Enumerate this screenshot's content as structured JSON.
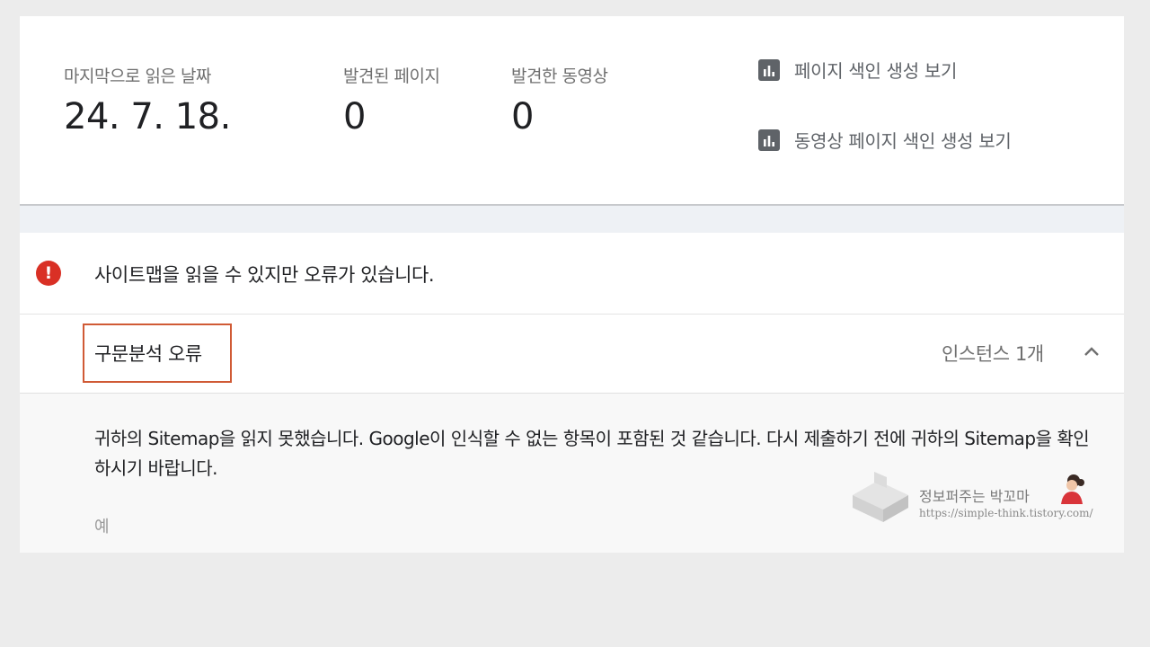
{
  "stats": {
    "last_read": {
      "label": "마지막으로 읽은 날짜",
      "value": "24. 7. 18."
    },
    "pages_found": {
      "label": "발견된 페이지",
      "value": "0"
    },
    "videos_found": {
      "label": "발견한 동영상",
      "value": "0"
    }
  },
  "links": {
    "page_indexing": {
      "label": "페이지 색인 생성 보기",
      "icon": "bar-chart-icon"
    },
    "video_indexing": {
      "label": "동영상 페이지 색인 생성 보기",
      "icon": "bar-chart-icon"
    }
  },
  "error": {
    "icon": "error-icon",
    "icon_glyph": "!",
    "message": "사이트맵을 읽을 수 있지만 오류가 있습니다."
  },
  "parse_error": {
    "title": "구문분석 오류",
    "instances": "인스턴스 1개",
    "highlight_color": "#d05a35",
    "detail": "귀하의 Sitemap을 읽지 못했습니다. Google이 인식할 수 없는 항목이 포함된 것 같습니다. 다시 제출하기 전에 귀하의 Sitemap을 확인하시기 바랍니다.",
    "example_label": "예"
  },
  "watermark": {
    "name": "정보퍼주는 박꼬마",
    "url": "https://simple-think.tistory.com/"
  },
  "colors": {
    "error_red": "#d93025",
    "icon_gray": "#5f6368",
    "divider_band": "#eef1f5"
  }
}
